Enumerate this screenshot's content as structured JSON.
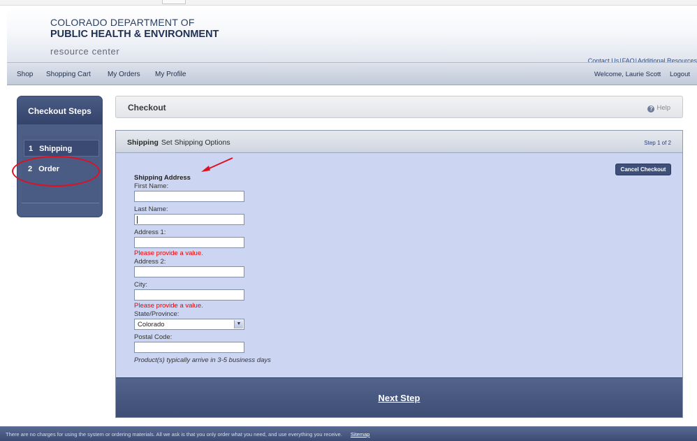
{
  "header": {
    "line1": "COLORADO DEPARTMENT OF",
    "line2": "PUBLIC HEALTH & ENVIRONMENT",
    "line3": "resource center",
    "links": [
      "Contact Us",
      "FAQ",
      "Additional Resources"
    ],
    "separator": "|"
  },
  "nav": {
    "items": [
      "Shop",
      "Shopping Cart",
      "My Orders",
      "My Profile"
    ],
    "welcome": "Welcome, Laurie Scott",
    "logout": "Logout"
  },
  "steps": {
    "title": "Checkout Steps",
    "items": [
      {
        "num": "1",
        "label": "Shipping"
      },
      {
        "num": "2",
        "label": "Order"
      }
    ]
  },
  "checkout": {
    "title": "Checkout",
    "help": "Help"
  },
  "panel": {
    "title_bold": "Shipping",
    "title_rest": "Set Shipping Options",
    "step_of": "Step 1 of 2",
    "cancel": "Cancel Checkout",
    "next": "Next Step"
  },
  "form": {
    "section": "Shipping Address",
    "first_name": "First Name:",
    "last_name": "Last Name:",
    "address1": "Address 1:",
    "address1_error": "Please provide a value.",
    "address2": "Address 2:",
    "city": "City:",
    "city_error": "Please provide a value.",
    "state": "State/Province:",
    "state_value": "Colorado",
    "postal": "Postal Code:",
    "note": "Product(s) typically arrive in 3-5 business days"
  },
  "footer": {
    "text": "There are no charges for using the system or ordering materials. All we ask is that you only order what you need, and use everything you receive.",
    "sitemap": "Sitemap"
  },
  "colors": {
    "annotation": "#e01020",
    "panel_bg": "#ccd6f2",
    "nav_dark": "#3d4d74"
  }
}
